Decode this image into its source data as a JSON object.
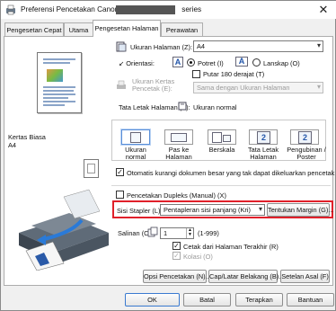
{
  "window": {
    "title": "Preferensi Pencetakan Canon",
    "title_suffix": "series",
    "close_glyph": "✕"
  },
  "tabs": [
    {
      "label": "Pengesetan Cepat"
    },
    {
      "label": "Utama"
    },
    {
      "label": "Pengesetan Halaman"
    },
    {
      "label": "Perawatan"
    }
  ],
  "preview": {
    "paper_line1": "Kertas Biasa",
    "paper_line2": "A4"
  },
  "page_size": {
    "label": "Ukuran Halaman (Z):",
    "value": "A4"
  },
  "orientation": {
    "label": "Orientasi:",
    "portrait": "Potret (I)",
    "landscape": "Lanskap (O)",
    "rotate": "Putar 180 derajat (T)"
  },
  "output_size": {
    "label_line1": "Ukuran Kertas",
    "label_line2": "Pencetak (E):",
    "value": "Sama dengan Ukuran Halaman"
  },
  "page_layout": {
    "label": "Tata Letak Halaman (Y):",
    "current": "Ukuran normal",
    "options": [
      {
        "line1": "Ukuran normal",
        "line2": ""
      },
      {
        "line1": "Pas ke",
        "line2": "Halaman"
      },
      {
        "line1": "Berskala",
        "line2": ""
      },
      {
        "line1": "Tata Letak",
        "line2": "Halaman"
      },
      {
        "line1": "Pengubinan /",
        "line2": "Poster"
      }
    ],
    "tile_glyph_2": "2"
  },
  "auto_reduce": {
    "label": "Otomatis kurangi dokumen besar yang tak dapat dikeluarkan pencetak (W)"
  },
  "duplex": {
    "label": "Pencetakan Dupleks (Manual) (X)"
  },
  "stapling": {
    "label": "Sisi Stapler (L):",
    "value": "Pentapleran sisi panjang (Kri)",
    "margin_button": "Tentukan Margin (G)..."
  },
  "copies": {
    "label": "Salinan (C):",
    "value": "1",
    "range": "(1-999)",
    "last_page": "Cetak dari Halaman Terakhir (R)",
    "collate": "Kolasi (O)",
    "check_glyph": "✓"
  },
  "bottom_row": {
    "print_options": "Opsi Pencetakan (N)...",
    "stamp": "Cap/Latar Belakang (B)...",
    "defaults": "Setelan Asal (F)"
  },
  "footer": {
    "ok": "OK",
    "cancel": "Batal",
    "apply": "Terapkan",
    "help": "Bantuan"
  },
  "colors": {
    "highlight": "#e0202a",
    "accent": "#2255aa"
  }
}
